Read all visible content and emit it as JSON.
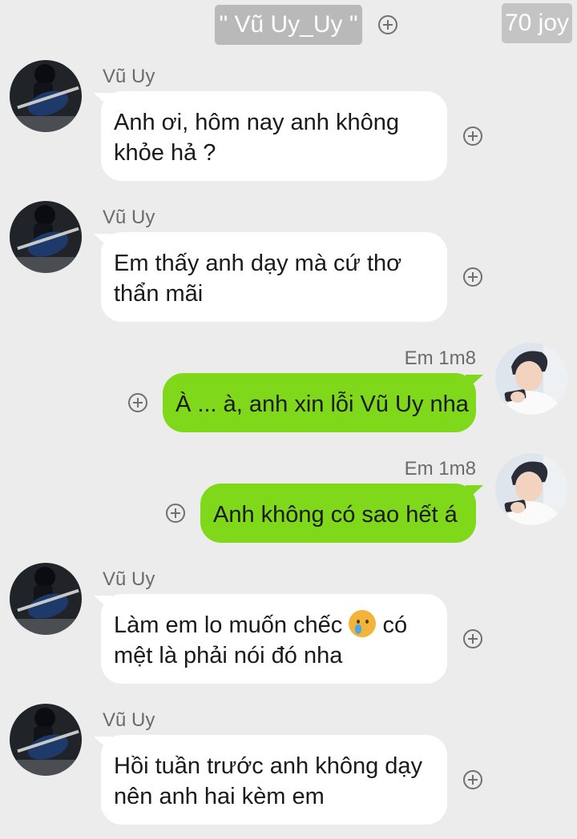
{
  "header": {
    "chat_title": "\" Vũ Uy_Uy \"",
    "count_label": "70 joy",
    "add_icon": "plus-circle-icon"
  },
  "colors": {
    "background": "#ececec",
    "incoming_bubble": "#ffffff",
    "outgoing_bubble": "#7fd81a",
    "meta_text": "#6b6b6b"
  },
  "messages": [
    {
      "direction": "incoming",
      "sender": "Vũ Uy",
      "lines": [
        "Anh ơi, hôm nay anh không",
        "khỏe hả ?"
      ],
      "action_icon": "plus-circle-icon"
    },
    {
      "direction": "incoming",
      "sender": "Vũ Uy",
      "lines": [
        "Em thấy anh dạy mà cứ thơ",
        "thẩn mãi"
      ],
      "action_icon": "plus-circle-icon"
    },
    {
      "direction": "outgoing",
      "sender": "Em 1m8",
      "lines": [
        "À ... à, anh xin lỗi Vũ Uy nha"
      ],
      "action_icon": "plus-circle-icon"
    },
    {
      "direction": "outgoing",
      "sender": "Em 1m8",
      "lines": [
        "Anh không có sao hết á"
      ],
      "action_icon": "plus-circle-icon"
    },
    {
      "direction": "incoming",
      "sender": "Vũ Uy",
      "lines": [
        "Làm em lo muốn chếc",
        "có",
        "mệt là phải nói đó nha"
      ],
      "emoji": "crying-face-emoji",
      "action_icon": "plus-circle-icon"
    },
    {
      "direction": "incoming",
      "sender": "Vũ Uy",
      "lines": [
        "Hồi tuần trước anh không dạy",
        "nên anh hai kèm em"
      ],
      "action_icon": "plus-circle-icon"
    }
  ]
}
